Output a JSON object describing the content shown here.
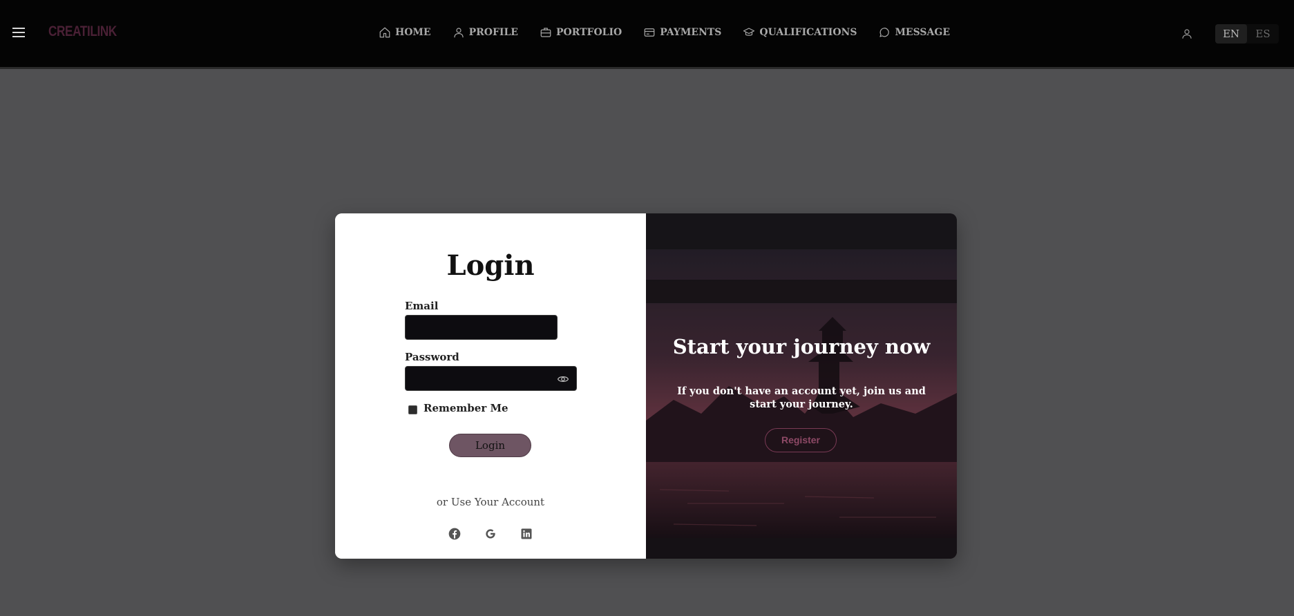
{
  "app": {
    "logo": "CREATILINK"
  },
  "nav": {
    "items": [
      {
        "label": "HOME",
        "icon": "home-icon"
      },
      {
        "label": "PROFILE",
        "icon": "user-icon"
      },
      {
        "label": "PORTFOLIO",
        "icon": "briefcase-icon"
      },
      {
        "label": "PAYMENTS",
        "icon": "credit-card-icon"
      },
      {
        "label": "QUALIFICATIONS",
        "icon": "graduation-cap-icon"
      },
      {
        "label": "MESSAGE",
        "icon": "chat-bubble-icon"
      }
    ]
  },
  "language": {
    "options": [
      "EN",
      "ES"
    ],
    "selected": "EN"
  },
  "login": {
    "title": "Login",
    "email_label": "Email",
    "email_value": "",
    "password_label": "Password",
    "password_value": "",
    "remember_label": "Remember Me",
    "submit_label": "Login",
    "alt_text": "or Use Your Account",
    "social": [
      "facebook-icon",
      "google-icon",
      "linkedin-icon"
    ]
  },
  "register_panel": {
    "title": "Start your journey now",
    "subtitle": "If you don't have an account yet, join us and start your journey.",
    "button_label": "Register"
  },
  "colors": {
    "page_bg": "#505052",
    "topbar_bg": "#040404",
    "logo": "#4a2035",
    "login_button": "#6e5563",
    "register_accent": "#8e4966",
    "input_bg": "#0d0c10"
  }
}
